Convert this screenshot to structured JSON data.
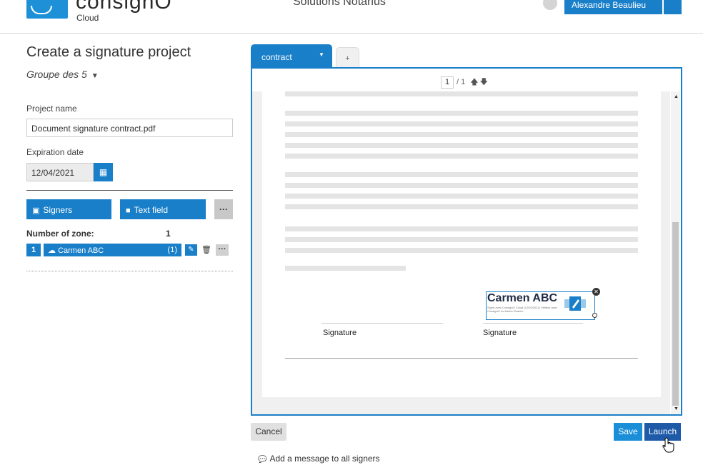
{
  "header": {
    "logo_text": "consignO",
    "logo_sub": "Cloud",
    "center_title": "Solutions Notarius",
    "user_name": "Alexandre Beaulieu"
  },
  "left": {
    "title": "Create a signature project",
    "group": "Groupe des 5",
    "project_name_label": "Project name",
    "project_name_value": "Document signature contract.pdf",
    "expiration_label": "Expiration date",
    "expiration_value": "12/04/2021",
    "signers_button": "Signers",
    "text_field_button": "Text field",
    "more_button": "···",
    "number_of_zone_label": "Number of zone:",
    "number_of_zone_value": "1",
    "zone": {
      "number": "1",
      "name": "Carmen ABC",
      "count": "(1)",
      "more": "···"
    }
  },
  "viewer": {
    "tab_label": "contract",
    "tab_add": "+",
    "page_current": "1",
    "page_total": "/ 1",
    "signature_label_left": "Signature",
    "signature_label_right": "Signature",
    "sig_name": "Carmen ABC",
    "sig_small_text": "Signé avec ConsignO Cloud (12/03/2021) Vérifiez avec ConsignO ou Adobe Reader."
  },
  "actions": {
    "cancel": "Cancel",
    "save": "Save",
    "launch": "Launch",
    "add_message": "Add a message to all signers"
  },
  "colors": {
    "primary": "#1a7fc9",
    "launch": "#1e5aa8"
  }
}
